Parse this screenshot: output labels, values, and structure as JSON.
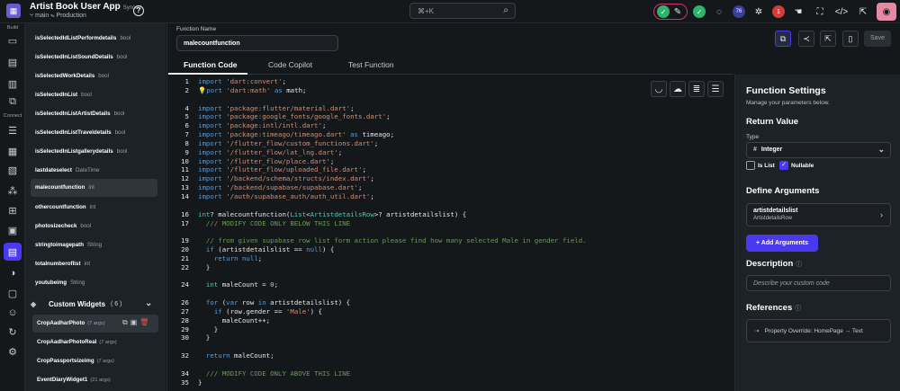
{
  "topbar": {
    "app_name": "Artist Book User App",
    "sync_status": "Synced",
    "branch": "⑂ main ✎ Production",
    "search_placeholder": "⌘+K",
    "badge_count": "76",
    "error_count": "1"
  },
  "rail": {
    "build_label": "Build",
    "connect_label": "Connect"
  },
  "list": {
    "items": [
      {
        "name": "isSelectedIdListPerformdetails",
        "type": "bool"
      },
      {
        "name": "isSelectedInListSoundDetails",
        "type": "bool"
      },
      {
        "name": "isSelectedWorkDetails",
        "type": "bool"
      },
      {
        "name": "isSelectedInList",
        "type": "bool"
      },
      {
        "name": "isSelectedInListArtistDetails",
        "type": "bool"
      },
      {
        "name": "isSelectedInListTraveldetails",
        "type": "bool"
      },
      {
        "name": "isSelectedInListgallerydetails",
        "type": "bool"
      },
      {
        "name": "lastdateselect",
        "type": "DateTime"
      },
      {
        "name": "malecountfunction",
        "type": "int"
      },
      {
        "name": "othercountfunction",
        "type": "int"
      },
      {
        "name": "photosizecheck",
        "type": "bool"
      },
      {
        "name": "stringtoimagepath",
        "type": "String"
      },
      {
        "name": "totalnumberoflist",
        "type": "int"
      },
      {
        "name": "youtubeimg",
        "type": "String"
      }
    ],
    "custom_widgets": {
      "title": "Custom Widgets",
      "count": "( 6 )",
      "items": [
        {
          "name": "CropAadharPhoto",
          "args": "(7 args)"
        },
        {
          "name": "CropAadharPhotoReal",
          "args": "(7 args)"
        },
        {
          "name": "CropPassportsizeimg",
          "args": "(7 args)"
        },
        {
          "name": "EventDiaryWidget1",
          "args": "(21 args)"
        }
      ]
    }
  },
  "editor": {
    "function_name_label": "Function Name",
    "function_name": "malecountfunction",
    "tabs": [
      "Function Code",
      "Code Copilot",
      "Test Function"
    ],
    "save_label": "Save"
  },
  "code_lines": [
    "1",
    "2",
    "3",
    "4",
    "5",
    "6",
    "7",
    "8",
    "9",
    "10",
    "11",
    "12",
    "13",
    "14",
    "15",
    "16",
    "17",
    "18",
    "19",
    "20",
    "21",
    "22",
    "23",
    "24",
    "25",
    "26",
    "27",
    "28",
    "29",
    "30",
    "31",
    "32",
    "33",
    "34",
    "35"
  ],
  "settings": {
    "title": "Function Settings",
    "subtitle": "Manage your parameters below.",
    "return_value": "Return Value",
    "type_label": "Type",
    "type_value": "Integer",
    "is_list": "Is List",
    "nullable": "Nullable",
    "define_arguments": "Define Arguments",
    "arg_name": "artistdetailslist",
    "arg_type": "ArtistdetailsRow",
    "add_arguments": "Add Arguments",
    "description": "Description",
    "description_placeholder": "Describe your custom code",
    "references": "References",
    "reference_item": "Property Override: HomePage → Text"
  }
}
